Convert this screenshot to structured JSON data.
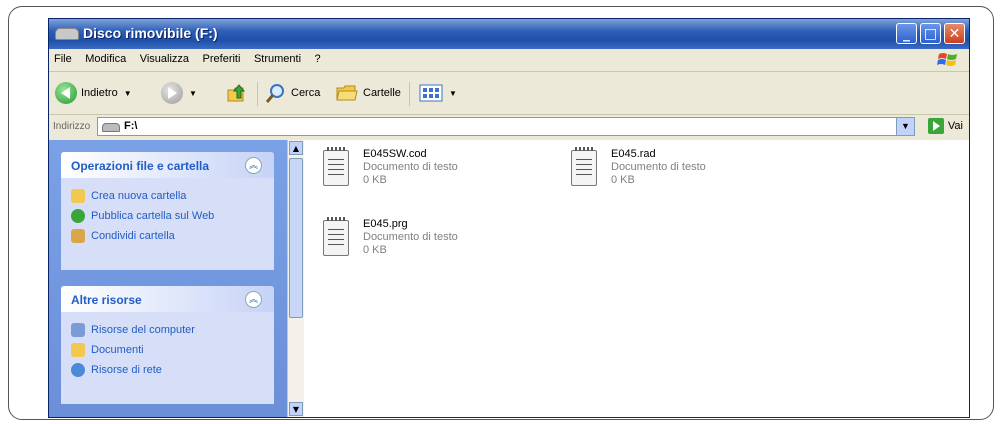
{
  "window": {
    "title": "Disco rimovibile (F:)"
  },
  "menu": [
    "File",
    "Modifica",
    "Visualizza",
    "Preferiti",
    "Strumenti",
    "?"
  ],
  "toolbar": {
    "back_label": "Indietro",
    "search_label": "Cerca",
    "folders_label": "Cartelle"
  },
  "address": {
    "label": "Indirizzo",
    "value": "F:\\",
    "go_label": "Vai"
  },
  "tasks_panel": {
    "title": "Operazioni file e cartella",
    "items": [
      "Crea nuova cartella",
      "Pubblica cartella sul Web",
      "Condividi cartella"
    ]
  },
  "other_panel": {
    "title": "Altre risorse",
    "items": [
      "Risorse del computer",
      "Documenti",
      "Risorse di rete"
    ]
  },
  "files": [
    {
      "name": "E045SW.cod",
      "type": "Documento di testo",
      "size": "0 KB"
    },
    {
      "name": "E045.rad",
      "type": "Documento di testo",
      "size": "0 KB"
    },
    {
      "name": "E045.prg",
      "type": "Documento di testo",
      "size": "0 KB"
    }
  ],
  "colors": {
    "titlebar": "#2e5fb8",
    "panel_link": "#215dc6",
    "pane_bg": "#7aa1e6"
  }
}
